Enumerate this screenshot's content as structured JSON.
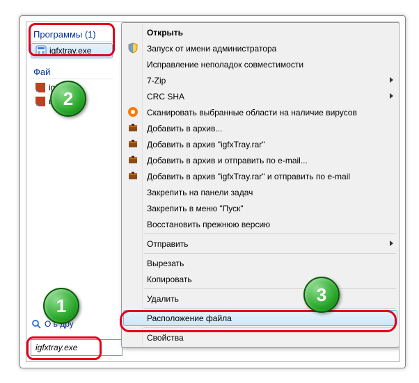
{
  "sidebar": {
    "programs_header": "Программы (1)",
    "program_item": "igfxtray.exe",
    "files_header": "Фай",
    "file_items": [
      "igfx...",
      "ый про..."
    ],
    "see_more": "О                ь дру"
  },
  "search": {
    "value": "igfxtray.exe"
  },
  "menu": {
    "open": "Открыть",
    "run_as_admin": "Запуск от имени администратора",
    "troubleshoot": "Исправление неполадок совместимости",
    "seven_zip": "7-Zip",
    "crc_sha": "CRC SHA",
    "scan_virus": "Сканировать выбранные области на наличие вирусов",
    "add_archive": "Добавить в архив...",
    "add_rar": "Добавить в архив \"igfxTray.rar\"",
    "add_email": "Добавить в архив и отправить по e-mail...",
    "add_rar_email": "Добавить в архив \"igfxTray.rar\" и отправить по e-mail",
    "pin_taskbar": "Закрепить на панели задач",
    "pin_start": "Закрепить в меню \"Пуск\"",
    "restore_prev": "Восстановить прежнюю версию",
    "send_to": "Отправить",
    "cut": "Вырезать",
    "copy": "Копировать",
    "delete": "Удалить",
    "file_location": "Расположение файла",
    "properties": "Свойства"
  },
  "badges": {
    "b1": "1",
    "b2": "2",
    "b3": "3"
  }
}
